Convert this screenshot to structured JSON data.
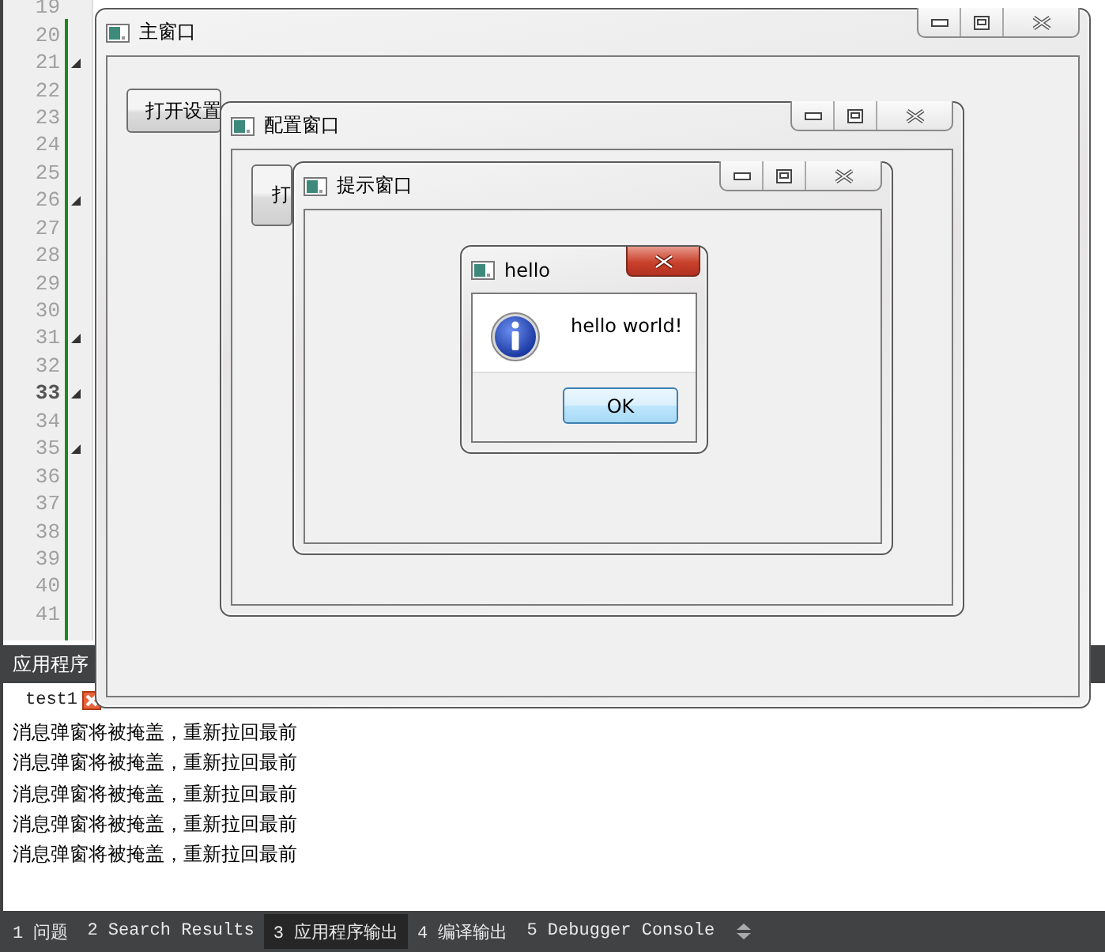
{
  "editor": {
    "lines": [
      {
        "number": "19",
        "current": false,
        "fold": false
      },
      {
        "number": "20",
        "current": false,
        "fold": false
      },
      {
        "number": "21",
        "current": false,
        "fold": true
      },
      {
        "number": "22",
        "current": false,
        "fold": false
      },
      {
        "number": "23",
        "current": false,
        "fold": false
      },
      {
        "number": "24",
        "current": false,
        "fold": false
      },
      {
        "number": "25",
        "current": false,
        "fold": false
      },
      {
        "number": "26",
        "current": false,
        "fold": true
      },
      {
        "number": "27",
        "current": false,
        "fold": false
      },
      {
        "number": "28",
        "current": false,
        "fold": false
      },
      {
        "number": "29",
        "current": false,
        "fold": false
      },
      {
        "number": "30",
        "current": false,
        "fold": false
      },
      {
        "number": "31",
        "current": false,
        "fold": true
      },
      {
        "number": "32",
        "current": false,
        "fold": false
      },
      {
        "number": "33",
        "current": true,
        "fold": true
      },
      {
        "number": "34",
        "current": false,
        "fold": false
      },
      {
        "number": "35",
        "current": false,
        "fold": true
      },
      {
        "number": "36",
        "current": false,
        "fold": false
      },
      {
        "number": "37",
        "current": false,
        "fold": false
      },
      {
        "number": "38",
        "current": false,
        "fold": false
      },
      {
        "number": "39",
        "current": false,
        "fold": false
      },
      {
        "number": "40",
        "current": false,
        "fold": false
      },
      {
        "number": "41",
        "current": false,
        "fold": false
      }
    ]
  },
  "output_pane": {
    "title": "应用程序",
    "tab": "test1",
    "lines": [
      "消息弹窗将被掩盖，重新拉回最前",
      "消息弹窗将被掩盖，重新拉回最前",
      "消息弹窗将被掩盖，重新拉回最前",
      "消息弹窗将被掩盖，重新拉回最前",
      "消息弹窗将被掩盖，重新拉回最前"
    ]
  },
  "bottom_tabs": [
    {
      "number": "1",
      "label": "问题",
      "selected": false
    },
    {
      "number": "2",
      "label": "Search Results",
      "selected": false
    },
    {
      "number": "3",
      "label": "应用程序输出",
      "selected": true
    },
    {
      "number": "4",
      "label": "编译输出",
      "selected": false
    },
    {
      "number": "5",
      "label": "Debugger Console",
      "selected": false
    }
  ],
  "windows": [
    {
      "title": "主窗口",
      "button": "打开设置"
    },
    {
      "title": "配置窗口",
      "button": "打"
    },
    {
      "title": "提示窗口"
    }
  ],
  "dialog": {
    "title": "hello",
    "message": "hello world!",
    "button": "OK"
  }
}
